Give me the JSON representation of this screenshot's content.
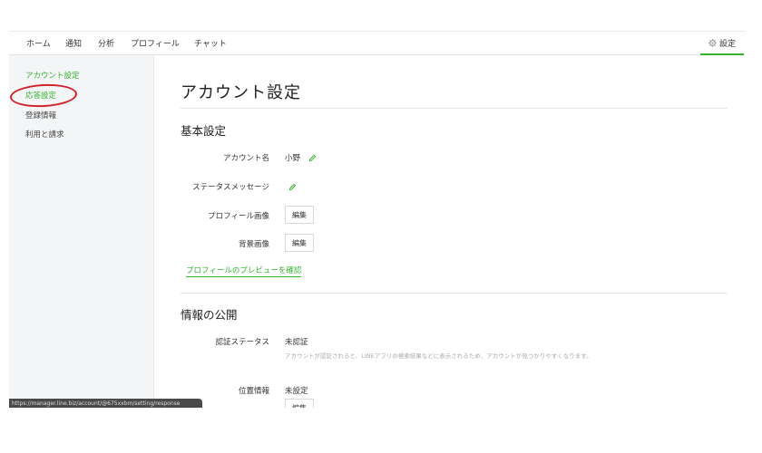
{
  "nav": {
    "items": [
      "ホーム",
      "通知",
      "分析",
      "プロフィール",
      "チャット"
    ],
    "settings_label": "設定"
  },
  "sidebar": {
    "items": [
      {
        "label": "アカウント設定",
        "active": true
      },
      {
        "label": "応答設定",
        "active": true
      },
      {
        "label": "登録情報",
        "active": false
      },
      {
        "label": "利用と請求",
        "active": false
      }
    ]
  },
  "status_bar": {
    "url": "https://manager.line.biz/account/@675xxbm/setting/response"
  },
  "main": {
    "page_title": "アカウント設定",
    "basic": {
      "title": "基本設定",
      "account_name_label": "アカウント名",
      "account_name_value": "小野",
      "status_message_label": "ステータスメッセージ",
      "profile_image_label": "プロフィール画像",
      "background_image_label": "背景画像",
      "edit_label": "編集",
      "preview_link": "プロフィールのプレビューを確認"
    },
    "publish": {
      "title": "情報の公開",
      "verify_label": "認証ステータス",
      "verify_value": "未認証",
      "verify_help": "アカウントが認証されると、LINEアプリの検索結果などに表示されるため、アカウントが見つかりやすくなります。",
      "location_label": "位置情報",
      "location_value": "未設定",
      "edit_label": "編集"
    }
  },
  "colors": {
    "accent": "#2fb32f",
    "annotation": "#d1212a",
    "sidebar_bg": "#f4f5f6"
  }
}
